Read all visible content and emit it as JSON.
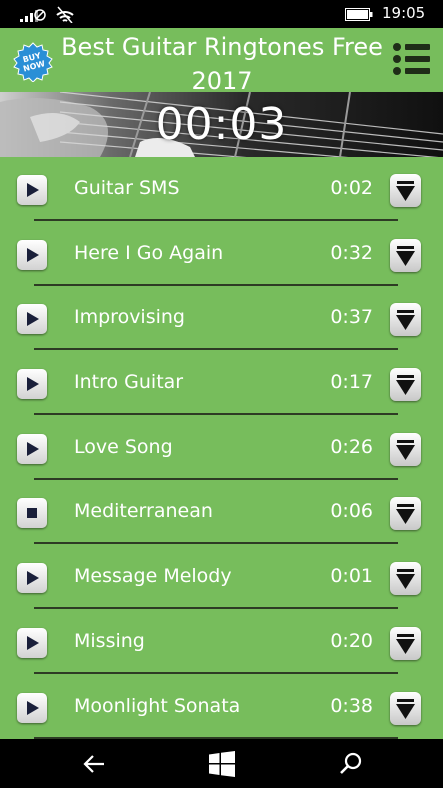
{
  "status_bar": {
    "time": "19:05"
  },
  "header": {
    "title": "Best Guitar Ringtones Free 2017",
    "badge_text_1": "BUY",
    "badge_text_2": "NOW"
  },
  "player": {
    "timer": "00:03"
  },
  "tracks": [
    {
      "name": "Guitar SMS",
      "duration": "0:02",
      "state": "play"
    },
    {
      "name": "Here I Go Again",
      "duration": "0:32",
      "state": "play"
    },
    {
      "name": "Improvising",
      "duration": "0:37",
      "state": "play"
    },
    {
      "name": "Intro Guitar",
      "duration": "0:17",
      "state": "play"
    },
    {
      "name": "Love Song",
      "duration": "0:26",
      "state": "play"
    },
    {
      "name": "Mediterranean",
      "duration": "0:06",
      "state": "stop"
    },
    {
      "name": "Message Melody",
      "duration": "0:01",
      "state": "play"
    },
    {
      "name": "Missing",
      "duration": "0:20",
      "state": "play"
    },
    {
      "name": "Moonlight Sonata",
      "duration": "0:38",
      "state": "play"
    }
  ],
  "colors": {
    "accent": "#77bd5c",
    "bar": "#000000"
  }
}
